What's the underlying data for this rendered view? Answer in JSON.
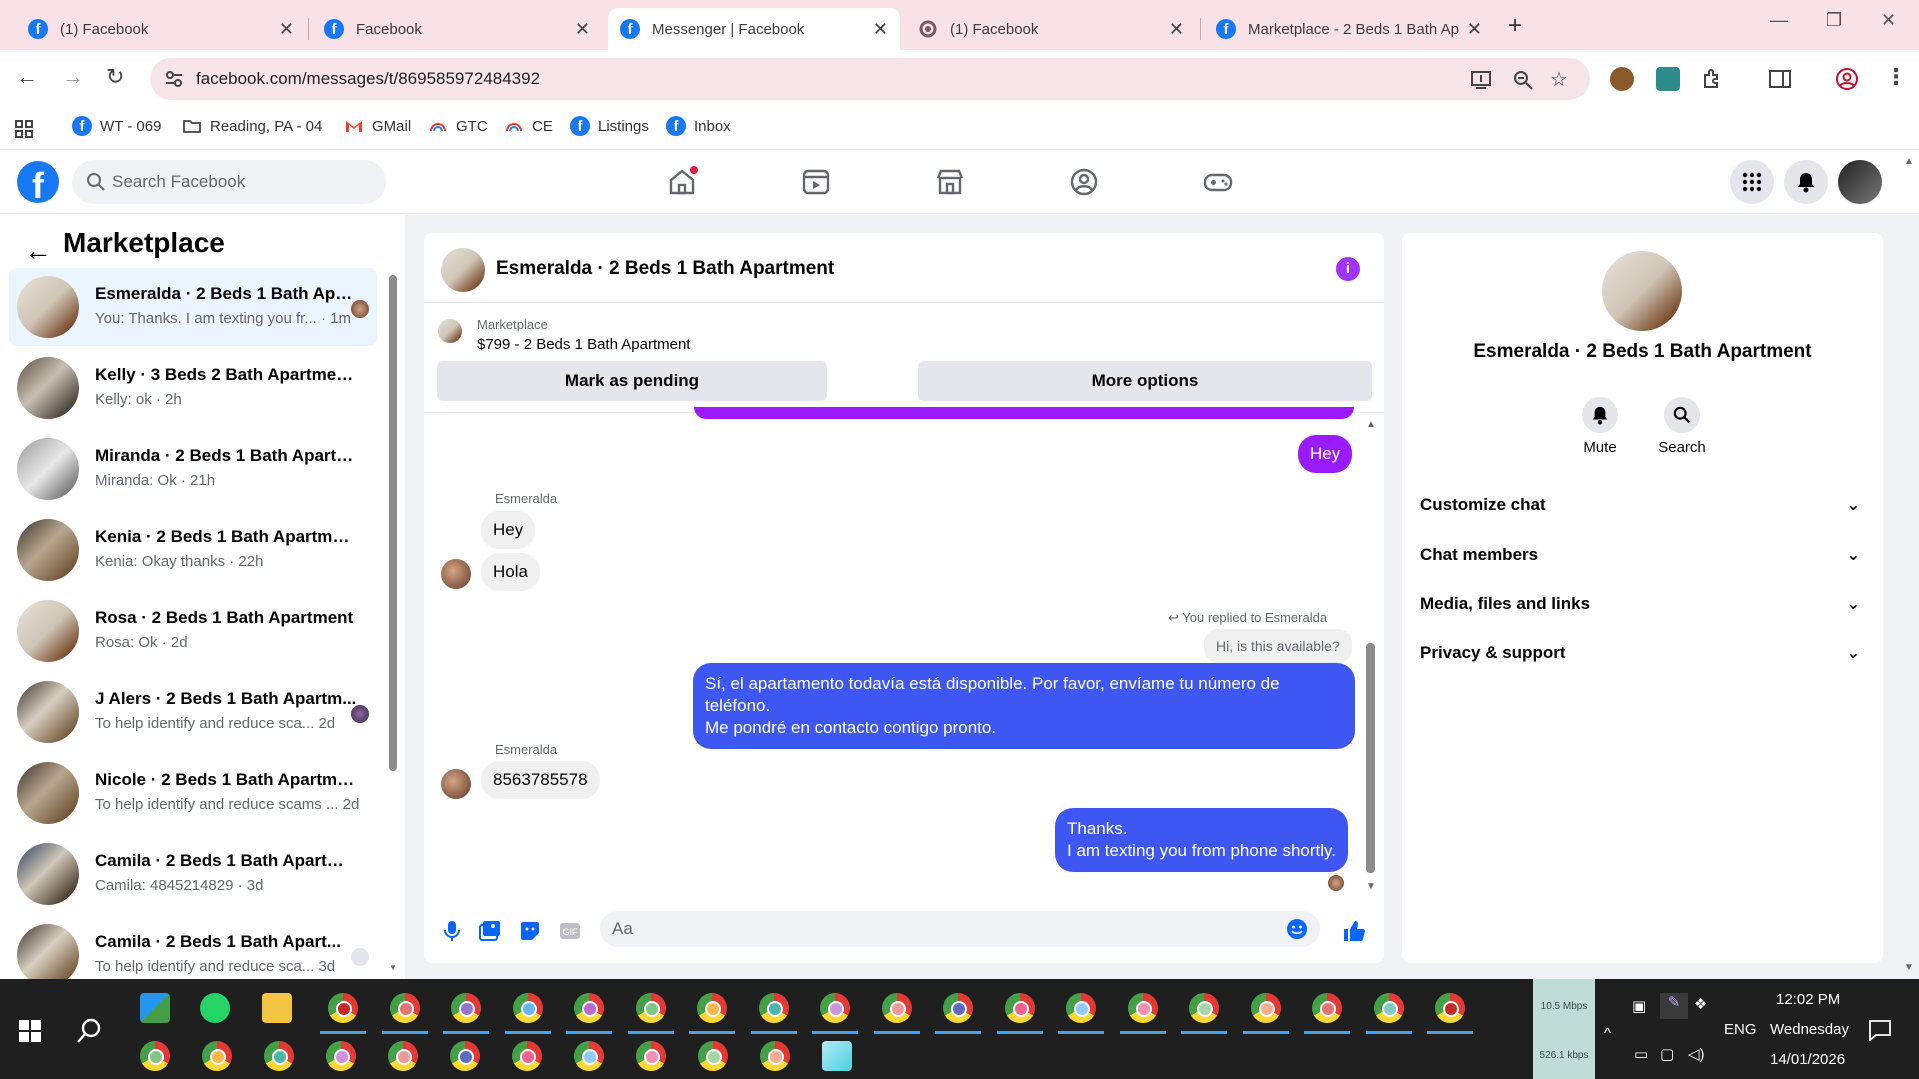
{
  "browser": {
    "tabs": [
      {
        "title": "(1) Facebook",
        "icon": "facebook-icon"
      },
      {
        "title": "Facebook",
        "icon": "facebook-icon"
      },
      {
        "title": "Messenger | Facebook",
        "icon": "facebook-icon",
        "active": true
      },
      {
        "title": "(1) Facebook",
        "icon": "loading-icon"
      },
      {
        "title": "Marketplace - 2 Beds 1 Bath Ap",
        "icon": "facebook-icon"
      }
    ],
    "url": "facebook.com/messages/t/869585972484392",
    "bookmarks": [
      {
        "label": "WT - 069",
        "icon": "facebook-icon"
      },
      {
        "label": "Reading, PA - 04",
        "icon": "folder-icon"
      },
      {
        "label": "GMail",
        "icon": "gmail-icon"
      },
      {
        "label": "GTC",
        "icon": "rainbow-icon"
      },
      {
        "label": "CE",
        "icon": "rainbow-icon"
      },
      {
        "label": "Listings",
        "icon": "facebook-icon"
      },
      {
        "label": "Inbox",
        "icon": "facebook-icon"
      }
    ]
  },
  "facebook": {
    "search_placeholder": "Search Facebook",
    "logo_letter": "f"
  },
  "marketplace": {
    "title": "Marketplace",
    "conversations": [
      {
        "name": "Esmeralda · 2 Beds 1 Bath Apa...",
        "preview": "You: Thanks. I am texting you fr... · 1m",
        "selected": true
      },
      {
        "name": "Kelly · 3 Beds 2 Bath Apartment ...",
        "preview": "Kelly: ok · 2h"
      },
      {
        "name": "Miranda · 2 Beds 1 Bath Apartm...",
        "preview": "Miranda: Ok · 21h"
      },
      {
        "name": "Kenia · 2 Beds 1 Bath Apartment...",
        "preview": "Kenia: Okay thanks · 22h"
      },
      {
        "name": "Rosa · 2 Beds 1 Bath Apartment",
        "preview": "Rosa: Ok · 2d"
      },
      {
        "name": "J Alers · 2 Beds 1 Bath Apartm...",
        "preview": "To help identify and reduce sca...   2d"
      },
      {
        "name": "Nicole · 2 Beds 1 Bath Apartmen...",
        "preview": "To help identify and reduce scams ...  2d"
      },
      {
        "name": "Camila · 2 Beds 1 Bath Apartment",
        "preview": "Camila: 4845214829 · 3d"
      },
      {
        "name": "Camila · 2 Beds 1 Bath Apart...",
        "preview": "To help identify and reduce sca...   3d"
      }
    ]
  },
  "chat": {
    "title": "Esmeralda · 2 Beds 1 Bath Apartment",
    "marketplace_label": "Marketplace",
    "listing": "$799 - 2 Beds 1 Bath Apartment",
    "mark_pending": "Mark as pending",
    "more_options": "More options",
    "messages": {
      "out_hey": "Hey",
      "sender1": "Esmeralda",
      "in_hey": "Hey",
      "in_hola": "Hola",
      "replied": "You replied to Esmeralda",
      "quoted": "Hi, is this available?",
      "out_spanish_1": "Sí, el apartamento todavía está disponible. Por favor, envíame tu número de teléfono.",
      "out_spanish_2": "Me pondré en contacto contigo pronto.",
      "sender2": "Esmeralda",
      "in_phone": "8563785578",
      "out_thanks_1": "Thanks.",
      "out_thanks_2": "I am texting you from phone shortly."
    },
    "composer_placeholder": "Aa",
    "colors": {
      "accent": "#a033ff",
      "blue": "#3f57f2",
      "purple": "#9a1bff"
    }
  },
  "details": {
    "title": "Esmeralda · 2 Beds 1 Bath Apartment",
    "mute": "Mute",
    "search": "Search",
    "sections": [
      "Customize chat",
      "Chat members",
      "Media, files and links",
      "Privacy & support"
    ]
  },
  "taskbar": {
    "net_up": "10.5 Mbps",
    "net_down": "526.1 kbps",
    "lang": "ENG",
    "time": "12:02 PM",
    "day": "Wednesday",
    "date": "14/01/2026"
  }
}
